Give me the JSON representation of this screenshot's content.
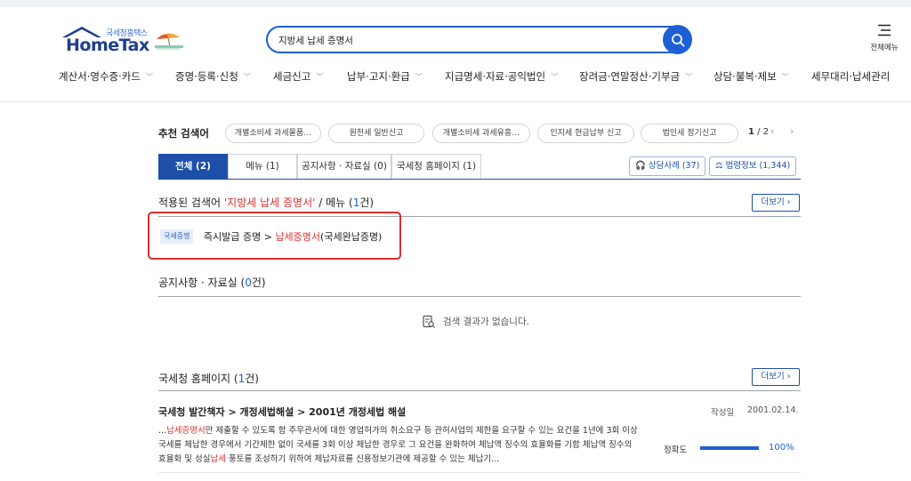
{
  "header": {
    "logo_sub": "국세청홈택스",
    "logo_main": "HomeTax",
    "search_value": "지방세 납세 증명서",
    "allmenu_label": "전체메뉴"
  },
  "gnb": [
    {
      "label": "계산서·영수증·카드"
    },
    {
      "label": "증명·등록·신청"
    },
    {
      "label": "세금신고"
    },
    {
      "label": "납부·고지·환급"
    },
    {
      "label": "지급명세·자료·공익법인"
    },
    {
      "label": "장려금·연말정산·기부금"
    },
    {
      "label": "상담·불복·제보"
    },
    {
      "label": "세무대리·납세관리"
    }
  ],
  "recommend": {
    "label": "추천 검색어",
    "chips": [
      "개별소비세 과세물품…",
      "원천세 일반신고",
      "개별소비세 과세유흥…",
      "인지세 현금납부 신고",
      "법인세 정기신고"
    ],
    "page_current": "1",
    "page_sep": " / ",
    "page_total": "2",
    "prev": "‹",
    "next": "›"
  },
  "tabs": [
    {
      "label": "전체 (2)",
      "active": true
    },
    {
      "label": "메뉴 (1)"
    },
    {
      "label": "공지사항 · 자료실 (0)"
    },
    {
      "label": "국세청 홈페이지 (1)"
    }
  ],
  "side_buttons": {
    "consult": "상담사례 (37)",
    "law": "법령정보 (1,344)"
  },
  "menu_section": {
    "prefix": "적용된 검색어 ",
    "keyword": "'지방세 납세 증명서'",
    "middle": " / 메뉴 (",
    "count": "1",
    "suffix": "건)",
    "more": "더보기 ›",
    "result": {
      "tag": "국세증명",
      "path": "즉시발급 증명 > ",
      "kw": "납세증명서",
      "rest": "(국세완납증명)"
    }
  },
  "notice_section": {
    "prefix": "공지사항 · 자료실 (",
    "count": "0",
    "suffix": "건)",
    "empty": "검색 결과가 없습니다."
  },
  "homepage_section": {
    "prefix": "국세청 홈페이지 (",
    "count": "1",
    "suffix": "건)",
    "more": "더보기 ›",
    "doc": {
      "title": "국세청 발간책자 > 개정세법해설 > 2001년 개정세법 해설",
      "date_label": "작성일",
      "date": "2001.02.14.",
      "line1_pre": "...",
      "line1_kw": "납세증명서",
      "line1_post": "만 제출할 수 있도록 함 주무관서에 대한 영업허가의 취소요구 등 관허사업의 제한을 요구할 수 있는 요건을 1년에 3회 이상",
      "line2": "국세를 체납한 경우에서 기간제한 없이 국세를 3회 이상 체납한 경우로 그 요건을 완화하여 체납액 징수의 효율화를 기함 체납액 징수의",
      "line3_pre": "효율화 및 성실",
      "line3_kw": "납세",
      "line3_post": " 풍토를 조성하기 위하여 체납자료를 신용정보기관에 제공할 수 있는 체납기...",
      "accuracy_label": "정확도",
      "accuracy": 100,
      "accuracy_text": "100%"
    }
  },
  "colors": {
    "primary": "#1d4fa8",
    "accent": "#1d5fd6",
    "keyword": "#d8302f",
    "highlight_box": "#d63030"
  }
}
